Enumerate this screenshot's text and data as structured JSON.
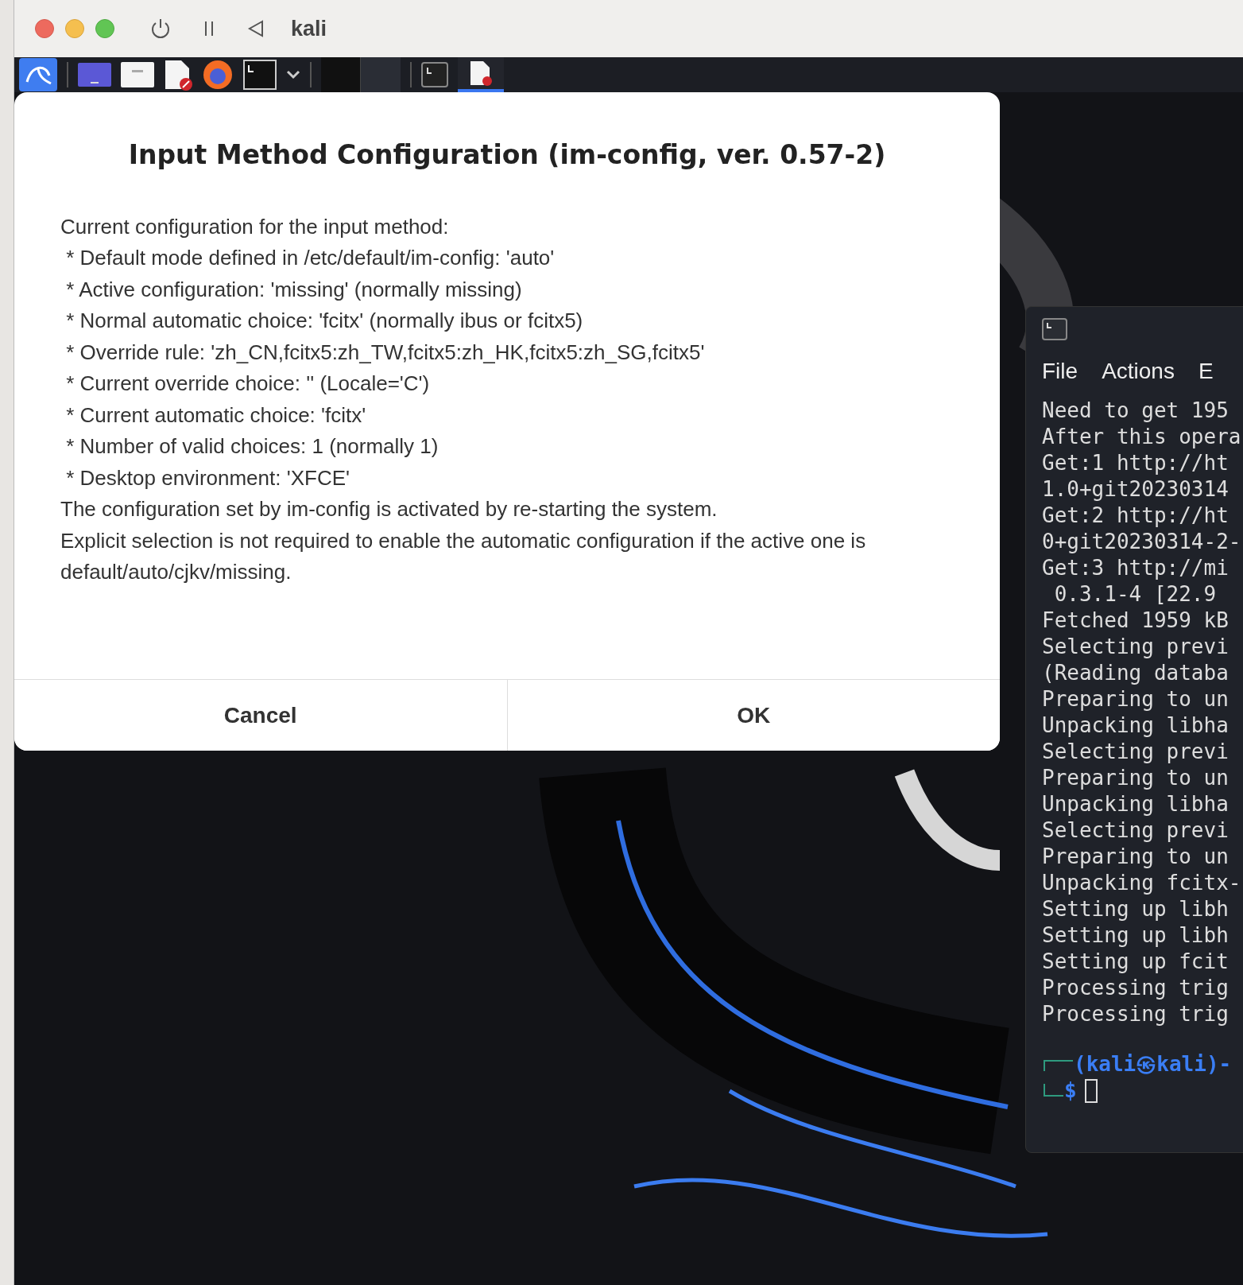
{
  "window": {
    "title": "kali"
  },
  "dialog": {
    "title": "Input Method Configuration (im-config, ver. 0.57-2)",
    "lines": [
      "Current configuration for the input method:",
      " * Default mode defined in /etc/default/im-config: 'auto'",
      " * Active configuration: 'missing' (normally missing)",
      " * Normal automatic choice: 'fcitx' (normally ibus or fcitx5)",
      " * Override rule: 'zh_CN,fcitx5:zh_TW,fcitx5:zh_HK,fcitx5:zh_SG,fcitx5'",
      " * Current override choice: '' (Locale='C')",
      " * Current automatic choice: 'fcitx'",
      " * Number of valid choices: 1 (normally 1)",
      " * Desktop environment: 'XFCE'",
      "The configuration set by im-config is activated by re-starting the system.",
      "Explicit selection is not required to enable the automatic configuration if the active one is default/auto/cjkv/missing."
    ],
    "buttons": [
      "Cancel",
      "OK"
    ]
  },
  "terminal": {
    "menu": [
      "File",
      "Actions",
      "E"
    ],
    "lines": [
      "Need to get 195",
      "After this opera",
      "Get:1 http://ht",
      "1.0+git20230314",
      "Get:2 http://ht",
      "0+git20230314-2-",
      "Get:3 http://mi",
      " 0.3.1-4 [22.9",
      "Fetched 1959 kB",
      "Selecting previ",
      "(Reading databa",
      "Preparing to un",
      "Unpacking libha",
      "Selecting previ",
      "Preparing to un",
      "Unpacking libha",
      "Selecting previ",
      "Preparing to un",
      "Unpacking fcitx-",
      "Setting up libh",
      "Setting up libh",
      "Setting up fcit",
      "Processing trig",
      "Processing trig"
    ],
    "prompt_user": "(kali㉿kali)-",
    "prompt_sign": "$"
  }
}
